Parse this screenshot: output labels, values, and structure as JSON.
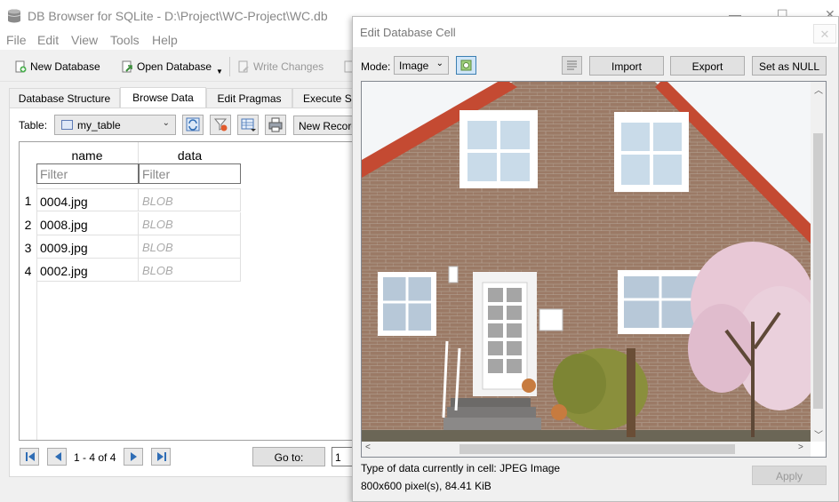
{
  "main_window": {
    "title": "DB Browser for SQLite - D:\\Project\\WC-Project\\WC.db",
    "controls": {
      "minimize": "—",
      "maximize": "☐",
      "close": "✕"
    }
  },
  "menu": [
    "File",
    "Edit",
    "View",
    "Tools",
    "Help"
  ],
  "toolbar": {
    "new_database": "New Database",
    "open_database": "Open Database",
    "write_changes": "Write Changes"
  },
  "tabs": [
    "Database Structure",
    "Browse Data",
    "Edit Pragmas",
    "Execute SQL"
  ],
  "active_tab": "Browse Data",
  "browse": {
    "table_label": "Table:",
    "table_selected": "my_table",
    "new_record": "New Record",
    "columns": [
      "name",
      "data"
    ],
    "filter_placeholder": "Filter",
    "rows": [
      {
        "num": "1",
        "name": "0004.jpg",
        "data": "BLOB"
      },
      {
        "num": "2",
        "name": "0008.jpg",
        "data": "BLOB"
      },
      {
        "num": "3",
        "name": "0009.jpg",
        "data": "BLOB"
      },
      {
        "num": "4",
        "name": "0002.jpg",
        "data": "BLOB"
      }
    ],
    "record_range": "1 - 4 of 4",
    "go_to_label": "Go to:",
    "go_to_value": "1"
  },
  "dialog": {
    "title": "Edit Database Cell",
    "close": "✕",
    "mode_label": "Mode:",
    "mode_value": "Image",
    "import": "Import",
    "export": "Export",
    "set_null": "Set as NULL",
    "type_info": "Type of data currently in cell: JPEG Image",
    "size_info": "800x600 pixel(s), 84.41 KiB",
    "apply": "Apply"
  },
  "colors": {
    "brick": "#9b7a66",
    "sky": "#f4f6f8",
    "roof_tiles": "#c44a32",
    "window_frame": "#ffffff",
    "glass": "#c9dbe9",
    "blossom": "#e8c8d6",
    "foliage": "#8a8f3c"
  }
}
